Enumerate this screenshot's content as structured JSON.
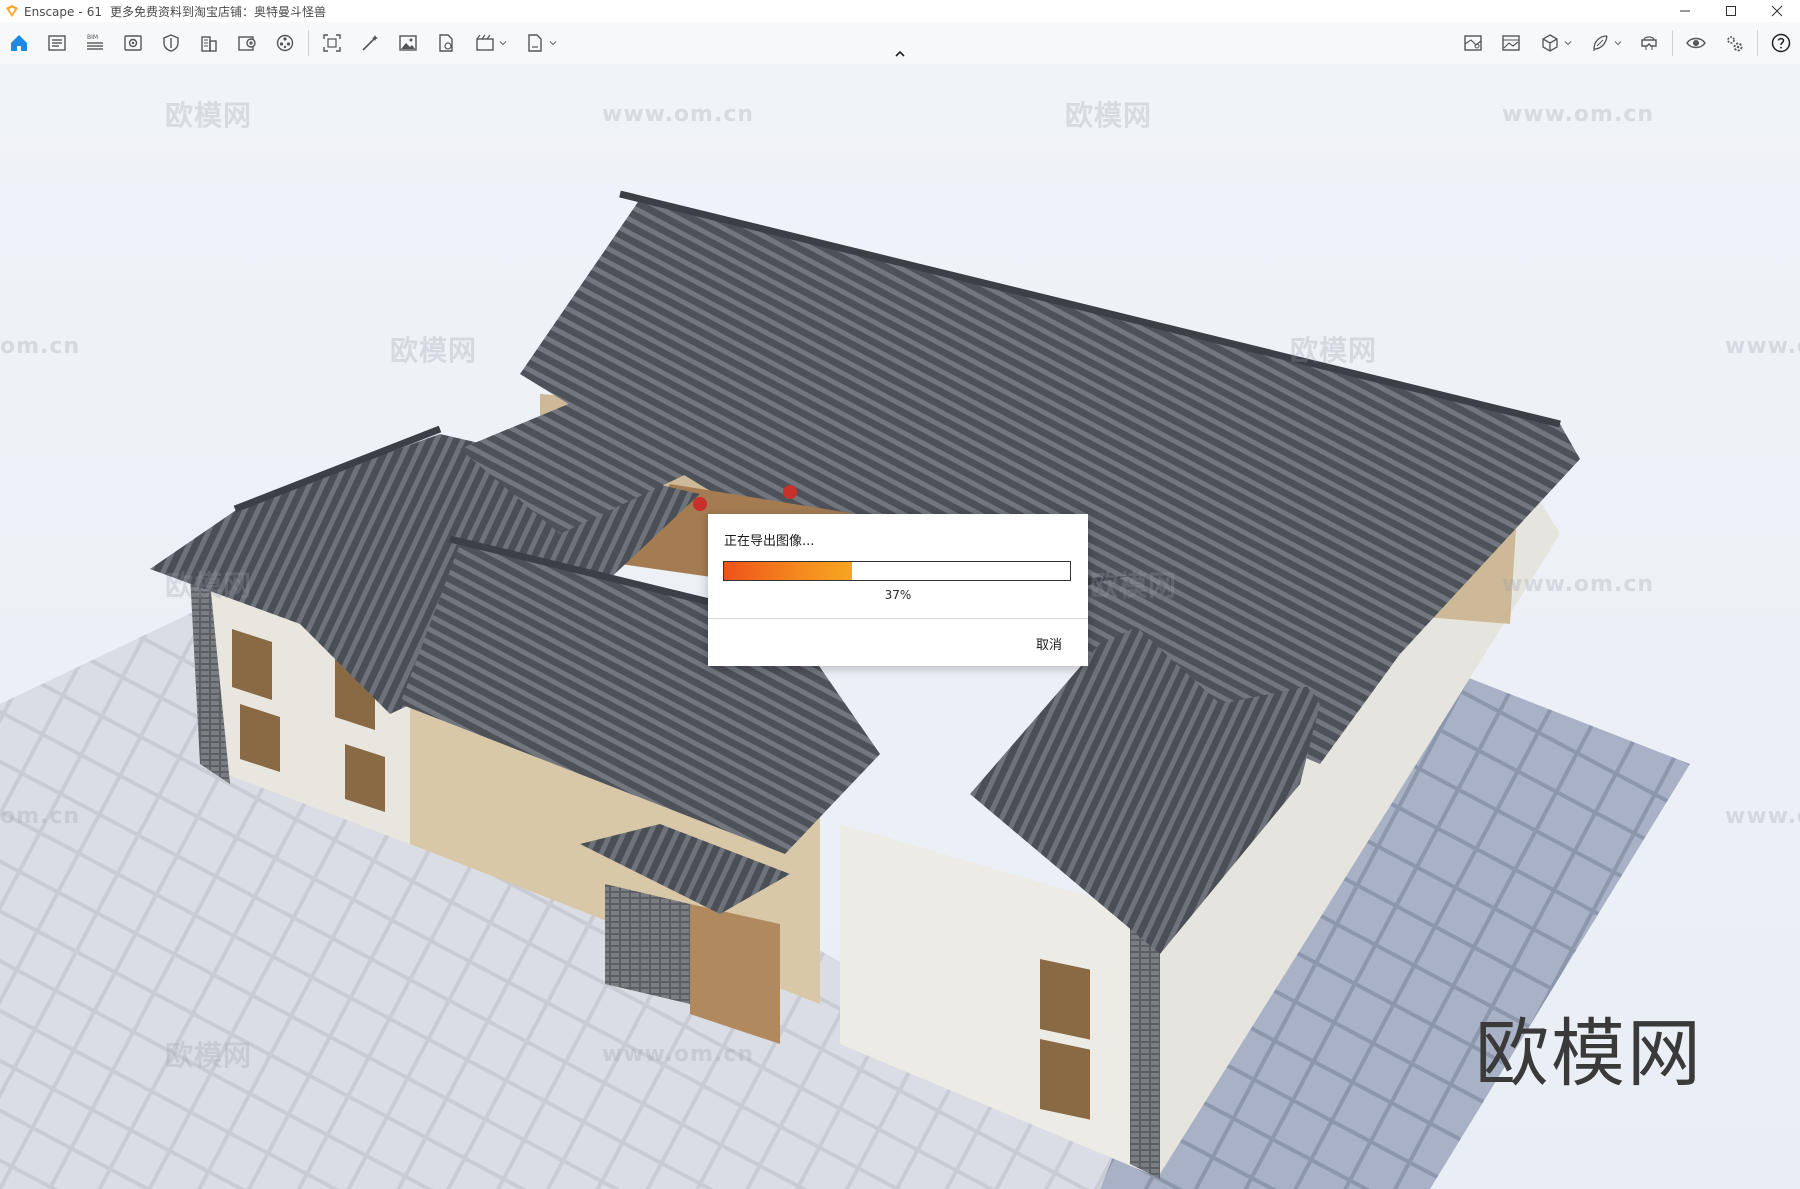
{
  "window": {
    "app_name": "Enscape",
    "separator": "-",
    "project": "61",
    "promo_text": "更多免费资料到淘宝店铺：奥特曼斗怪兽"
  },
  "toolbar": {
    "left_buttons": [
      {
        "name": "home-icon",
        "active": true
      },
      {
        "name": "views-icon"
      },
      {
        "name": "bim-icon",
        "label": "BIM"
      },
      {
        "name": "visual-settings-icon"
      },
      {
        "name": "shield-icon"
      },
      {
        "name": "building-icon"
      },
      {
        "name": "asset-library-icon"
      },
      {
        "name": "materials-icon"
      }
    ],
    "middle_buttons": [
      {
        "name": "screenshot-icon"
      },
      {
        "name": "magic-wand-icon"
      },
      {
        "name": "image-icon"
      },
      {
        "name": "document-icon"
      },
      {
        "name": "video-icon",
        "dropdown": true
      },
      {
        "name": "export-icon",
        "dropdown": true
      }
    ],
    "right_buttons": [
      {
        "name": "map-icon"
      },
      {
        "name": "gallery-icon"
      },
      {
        "name": "cube-icon",
        "dropdown": true
      },
      {
        "name": "feather-icon",
        "dropdown": true
      },
      {
        "name": "vr-headset-icon"
      },
      {
        "name": "eye-icon"
      },
      {
        "name": "settings-icon"
      },
      {
        "name": "help-icon"
      }
    ],
    "accent_color": "#1e88e5"
  },
  "viewport": {
    "watermarks": [
      "欧模网",
      "www.om.cn",
      "om.cn",
      "www.o"
    ],
    "big_watermark": "欧模网"
  },
  "export_dialog": {
    "title": "正在导出图像...",
    "progress_value": 0.37,
    "progress_text": "37%",
    "cancel_label": "取消",
    "progress_color": "#f36b1c"
  }
}
